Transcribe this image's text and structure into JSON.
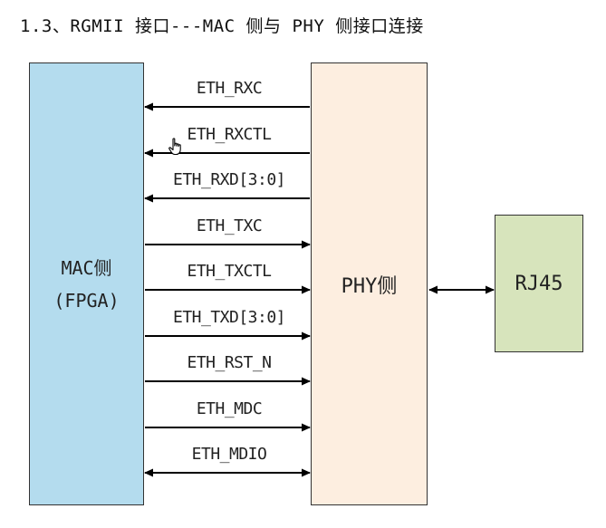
{
  "title": "1.3、RGMII 接口---MAC 侧与 PHY 侧接口连接",
  "colors": {
    "mac_fill": "#b4dcee",
    "phy_fill": "#fdeee0",
    "rj45_fill": "#d7e4bc",
    "line": "#000000"
  },
  "blocks": {
    "mac_line1": "MAC侧",
    "mac_line2": "(FPGA)",
    "phy": "PHY侧",
    "rj45": "RJ45"
  },
  "signals": [
    {
      "label": "ETH_RXC",
      "direction": "to-mac"
    },
    {
      "label": "ETH_RXCTL",
      "direction": "to-mac"
    },
    {
      "label": "ETH_RXD[3:0]",
      "direction": "to-mac"
    },
    {
      "label": "ETH_TXC",
      "direction": "to-phy"
    },
    {
      "label": "ETH_TXCTL",
      "direction": "to-phy"
    },
    {
      "label": "ETH_TXD[3:0]",
      "direction": "to-phy"
    },
    {
      "label": "ETH_RST_N",
      "direction": "to-phy"
    },
    {
      "label": "ETH_MDC",
      "direction": "to-phy"
    },
    {
      "label": "ETH_MDIO",
      "direction": "bidirectional"
    }
  ],
  "phy_rj45_link": "bidirectional",
  "cursor_icon": "hand-pointer-icon"
}
